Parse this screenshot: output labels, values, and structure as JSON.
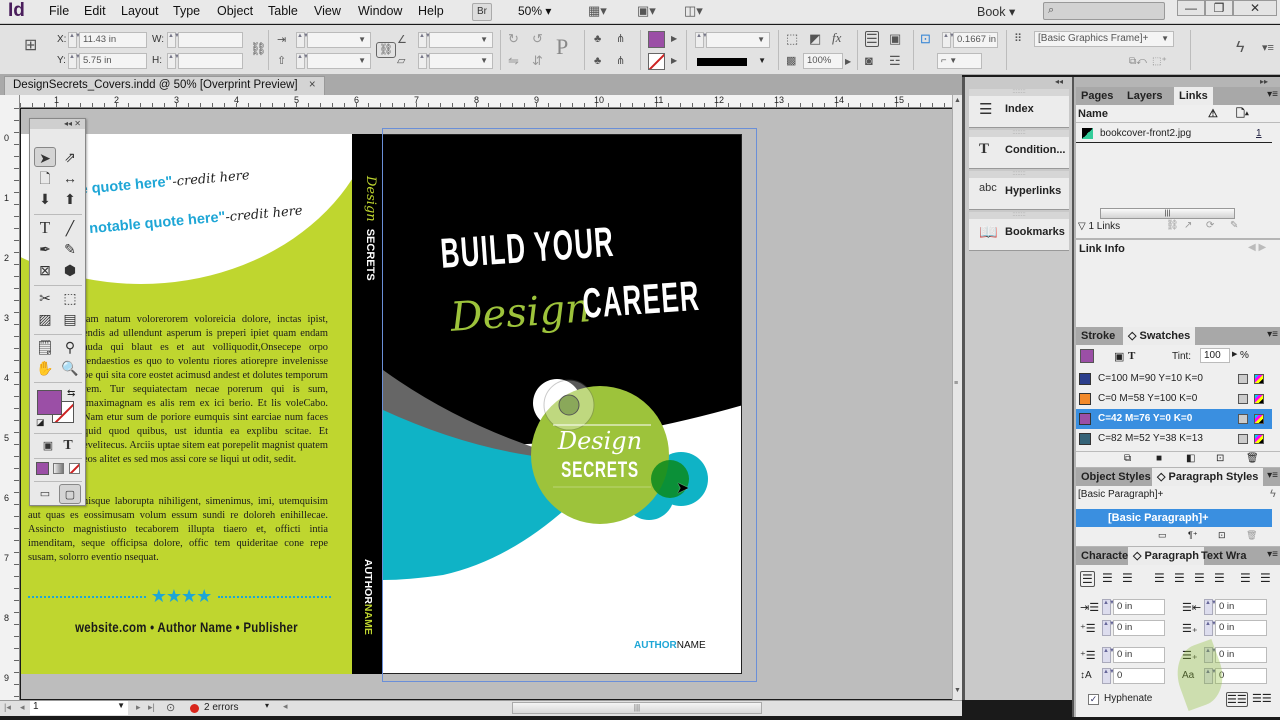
{
  "app": {
    "logo": "Id",
    "menu": [
      "File",
      "Edit",
      "Layout",
      "Type",
      "Object",
      "Table",
      "View",
      "Window",
      "Help"
    ],
    "bridge_button": "Br",
    "zoom_level": "50%",
    "workspace": "Book",
    "search_placeholder": "",
    "window_controls": {
      "minimize": "—",
      "restore": "❐",
      "close": "✕"
    }
  },
  "control_panel": {
    "x_label": "X:",
    "x_value": "11.43 in",
    "y_label": "Y:",
    "y_value": "5.75 in",
    "w_label": "W:",
    "w_value": "",
    "h_label": "H:",
    "h_value": "",
    "opacity_value": "100%",
    "stroke_weight_value": "0.1667 in",
    "object_style": "[Basic Graphics Frame]+",
    "fill_color": "#9b4fa6"
  },
  "document": {
    "tab_title": "DesignSecrets_Covers.indd @ 50% [Overprint Preview]",
    "tab_close": "×",
    "h_ruler_labels": [
      "1",
      "2",
      "3",
      "4",
      "5",
      "6",
      "7",
      "8",
      "9",
      "10",
      "11",
      "12",
      "13",
      "14",
      "15"
    ],
    "v_ruler_labels": [
      "0",
      "1",
      "2",
      "3",
      "4",
      "5",
      "6",
      "7",
      "8",
      "9"
    ]
  },
  "back_cover": {
    "quote1": "e quote here\"",
    "quote1_credit": "-credit here",
    "quote2": "r notable quote here\"",
    "quote2_credit": "-credit here",
    "paragraph1": "tam natum volorerorem voloreicia dolore, inctas ipist, endis ad ullendunt asperum is preperi ipiet quam endam auda qui blaut es et aut volliquodit,Onsecepe orpo rendaestios es quo to volentu riores atiorepre invelenisse pe qui sita core eostet acimusd andest et dolutes temporum rem. Tur sequiatectam necae porerum qui is sum, imaximagnam es alis rem ex ici berio. Et lis voleCabo. Nam etur sum de poriore eumquis sint earciae num faces quid quod quibus, ust iduntia ea explibu scitae. Et evelitecus. Arciis uptae sitem eat porepelit magnist quatem eos alitet es sed mos assi core se liqui ut odit, sedit.",
    "paragraph2": "nisque laborupta nihiligent, simenimus, imi, utemquisim aut quas es eossimusam volum essum sundi re doloreh enihillecae. Assincto magnistiusto tecaborem illupta tiaero et, officti intia imenditam, seque officipsa dolore, offic tem quideritae cone repe susam, solorro eventio nsequat.",
    "rating_stars": "★★★★",
    "footer": "website.com • Author Name • Publisher"
  },
  "spine": {
    "title_script": "Design",
    "title_caps": "SECRETS",
    "author_first": "AUTHOR",
    "author_last": "NAME"
  },
  "front_cover": {
    "headline_line1": "BUILD YOUR",
    "headline_script": "Design",
    "headline_line2": "CAREER",
    "badge_script": "Design",
    "badge_caps": "SECRETS",
    "author_first": "AUTHOR",
    "author_last": "NAME",
    "colors": {
      "lime": "#9dc33b",
      "teal": "#0fb3c6",
      "black": "#000000",
      "accent_blue": "#1ea6d6"
    }
  },
  "icon_panel": {
    "items": [
      {
        "label": "Index",
        "icon": "index-icon"
      },
      {
        "label": "Condition...",
        "icon": "conditional-text-icon"
      },
      {
        "label": "Hyperlinks",
        "icon": "hyperlinks-icon"
      },
      {
        "label": "Bookmarks",
        "icon": "bookmarks-icon"
      }
    ]
  },
  "links_panel": {
    "tabs": [
      "Pages",
      "Layers",
      "Links"
    ],
    "active_tab": "Links",
    "column_name": "Name",
    "files": [
      {
        "name": "bookcover-front2.jpg",
        "page": "1"
      }
    ],
    "count_label": "1 Links",
    "info_title": "Link Info"
  },
  "swatches_panel": {
    "tabs": [
      "Stroke",
      "Swatches"
    ],
    "active_tab": "Swatches",
    "tint_label": "Tint:",
    "tint_value": "100",
    "tint_unit": "%",
    "swatches": [
      {
        "name": "C=100 M=90 Y=10 K=0",
        "color": "#2b3e8c",
        "selected": false
      },
      {
        "name": "C=0 M=58 Y=100 K=0",
        "color": "#f2892a",
        "selected": false
      },
      {
        "name": "C=42 M=76 Y=0 K=0",
        "color": "#9b4fa6",
        "selected": true
      },
      {
        "name": "C=82 M=52 Y=38 K=13",
        "color": "#356378",
        "selected": false
      }
    ]
  },
  "styles_panel": {
    "tabs": [
      "Object Styles",
      "Paragraph Styles"
    ],
    "active_tab": "Paragraph Styles",
    "current_style": "[Basic Paragraph]+",
    "styles": [
      "[Basic Paragraph]+"
    ]
  },
  "paragraph_panel": {
    "tabs": [
      "Character",
      "Paragraph",
      "Text Wra"
    ],
    "active_tab": "Paragraph",
    "left_indent": "0 in",
    "right_indent": "0 in",
    "first_line_indent": "0 in",
    "last_line_indent": "0 in",
    "space_before": "0 in",
    "space_after": "0 in",
    "drop_cap_lines": "0",
    "drop_cap_chars": "0",
    "hyphenate_label": "Hyphenate",
    "hyphenate_checked": true
  },
  "status_bar": {
    "page_number": "1",
    "errors": "2 errors"
  }
}
